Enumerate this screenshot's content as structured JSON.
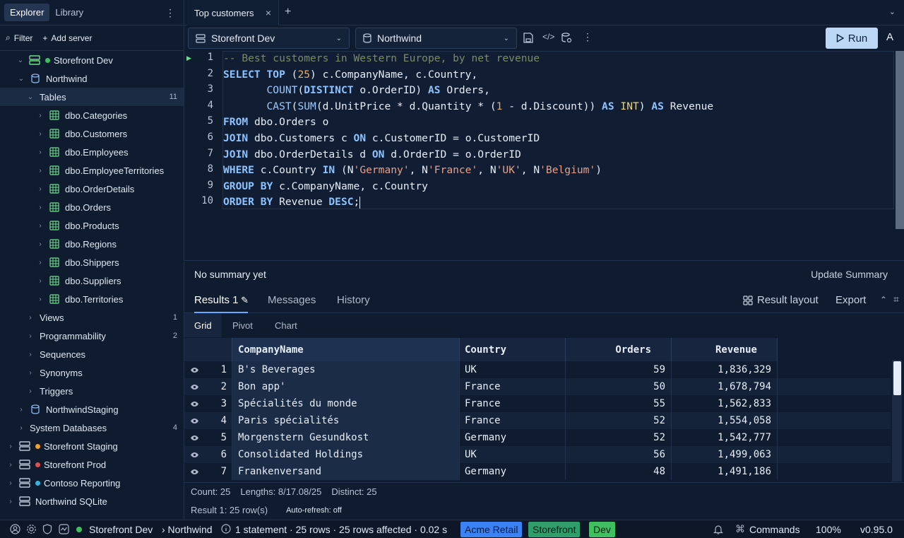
{
  "left": {
    "tabs": [
      "Explorer",
      "Library"
    ],
    "filter_label": "Filter",
    "add_server_label": "Add server",
    "tree": [
      {
        "label": "Storefront Dev",
        "count": ""
      },
      {
        "label": "Northwind",
        "count": ""
      },
      {
        "label": "Tables",
        "count": "11"
      },
      {
        "label": "dbo.Categories",
        "count": ""
      },
      {
        "label": "dbo.Customers",
        "count": ""
      },
      {
        "label": "dbo.Employees",
        "count": ""
      },
      {
        "label": "dbo.EmployeeTerritories",
        "count": ""
      },
      {
        "label": "dbo.OrderDetails",
        "count": ""
      },
      {
        "label": "dbo.Orders",
        "count": ""
      },
      {
        "label": "dbo.Products",
        "count": ""
      },
      {
        "label": "dbo.Regions",
        "count": ""
      },
      {
        "label": "dbo.Shippers",
        "count": ""
      },
      {
        "label": "dbo.Suppliers",
        "count": ""
      },
      {
        "label": "dbo.Territories",
        "count": ""
      },
      {
        "label": "Views",
        "count": "1"
      },
      {
        "label": "Programmability",
        "count": "2"
      },
      {
        "label": "Sequences",
        "count": ""
      },
      {
        "label": "Synonyms",
        "count": ""
      },
      {
        "label": "Triggers",
        "count": ""
      },
      {
        "label": "NorthwindStaging",
        "count": ""
      },
      {
        "label": "System Databases",
        "count": "4"
      },
      {
        "label": "Storefront Staging",
        "count": ""
      },
      {
        "label": "Storefront Prod",
        "count": ""
      },
      {
        "label": "Contoso Reporting",
        "count": ""
      },
      {
        "label": "Northwind SQLite",
        "count": ""
      }
    ]
  },
  "tab": {
    "title": "Top customers"
  },
  "toolbar": {
    "server": "Storefront Dev",
    "database": "Northwind",
    "run_label": "Run",
    "a_label": "A"
  },
  "code": {
    "line_numbers": [
      "1",
      "2",
      "3",
      "4",
      "5",
      "6",
      "7",
      "8",
      "9",
      "10"
    ],
    "lines": [
      "-- Best customers in Western Europe, by net revenue",
      "SELECT TOP (25) c.CompanyName, c.Country,",
      "       COUNT(DISTINCT o.OrderID) AS Orders,",
      "       CAST(SUM(d.UnitPrice * d.Quantity * (1 - d.Discount)) AS INT) AS Revenue",
      "FROM dbo.Orders o",
      "JOIN dbo.Customers c ON c.CustomerID = o.CustomerID",
      "JOIN dbo.OrderDetails d ON d.OrderID = o.OrderID",
      "WHERE c.Country IN (N'Germany', N'France', N'UK', N'Belgium')",
      "GROUP BY c.CompanyName, c.Country",
      "ORDER BY Revenue DESC;"
    ]
  },
  "summary": {
    "text": "No summary yet",
    "update_label": "Update Summary"
  },
  "results": {
    "tabs": [
      "Results 1",
      "Messages",
      "History"
    ],
    "result_layout_label": "Result layout",
    "export_label": "Export",
    "subtabs": [
      "Grid",
      "Pivot",
      "Chart"
    ],
    "columns": [
      "CompanyName",
      "Country",
      "Orders",
      "Revenue"
    ],
    "rows": [
      {
        "n": "1",
        "company": "B's Beverages",
        "country": "UK",
        "orders": "59",
        "revenue": "1,836,329"
      },
      {
        "n": "2",
        "company": "Bon app'",
        "country": "France",
        "orders": "50",
        "revenue": "1,678,794"
      },
      {
        "n": "3",
        "company": "Spécialités du monde",
        "country": "France",
        "orders": "55",
        "revenue": "1,562,833"
      },
      {
        "n": "4",
        "company": "Paris spécialités",
        "country": "France",
        "orders": "52",
        "revenue": "1,554,058"
      },
      {
        "n": "5",
        "company": "Morgenstern Gesundkost",
        "country": "Germany",
        "orders": "52",
        "revenue": "1,542,777"
      },
      {
        "n": "6",
        "company": "Consolidated Holdings",
        "country": "UK",
        "orders": "56",
        "revenue": "1,499,063"
      },
      {
        "n": "7",
        "company": "Frankenversand",
        "country": "Germany",
        "orders": "48",
        "revenue": "1,491,186"
      }
    ],
    "stats": {
      "count": "Count: 25",
      "lengths": "Lengths: 8/17.08/25",
      "distinct": "Distinct: 25"
    },
    "info": {
      "rows": "Result 1: 25 row(s)",
      "auto_refresh": "Auto-refresh: off"
    }
  },
  "status": {
    "connection": "Storefront Dev",
    "database": "› Northwind",
    "summary": "1 statement · 25 rows · 25 rows affected · 0.02 s",
    "chips": [
      {
        "label": "Acme Retail",
        "bg": "#3b82f6",
        "fg": "#0b1a33"
      },
      {
        "label": "Storefront",
        "bg": "#2f9e6a",
        "fg": "#0b1a14"
      },
      {
        "label": "Dev",
        "bg": "#3fbf5f",
        "fg": "#0b1a10"
      }
    ],
    "commands_label": "Commands",
    "zoom": "100%",
    "version": "v0.95.0"
  },
  "colors": {
    "accent": "#6aa7ff",
    "run_bg": "#bcd7f5",
    "green": "#3fbf5f",
    "orange": "#f0a030",
    "red": "#e05050",
    "blue": "#3bb0d8"
  }
}
